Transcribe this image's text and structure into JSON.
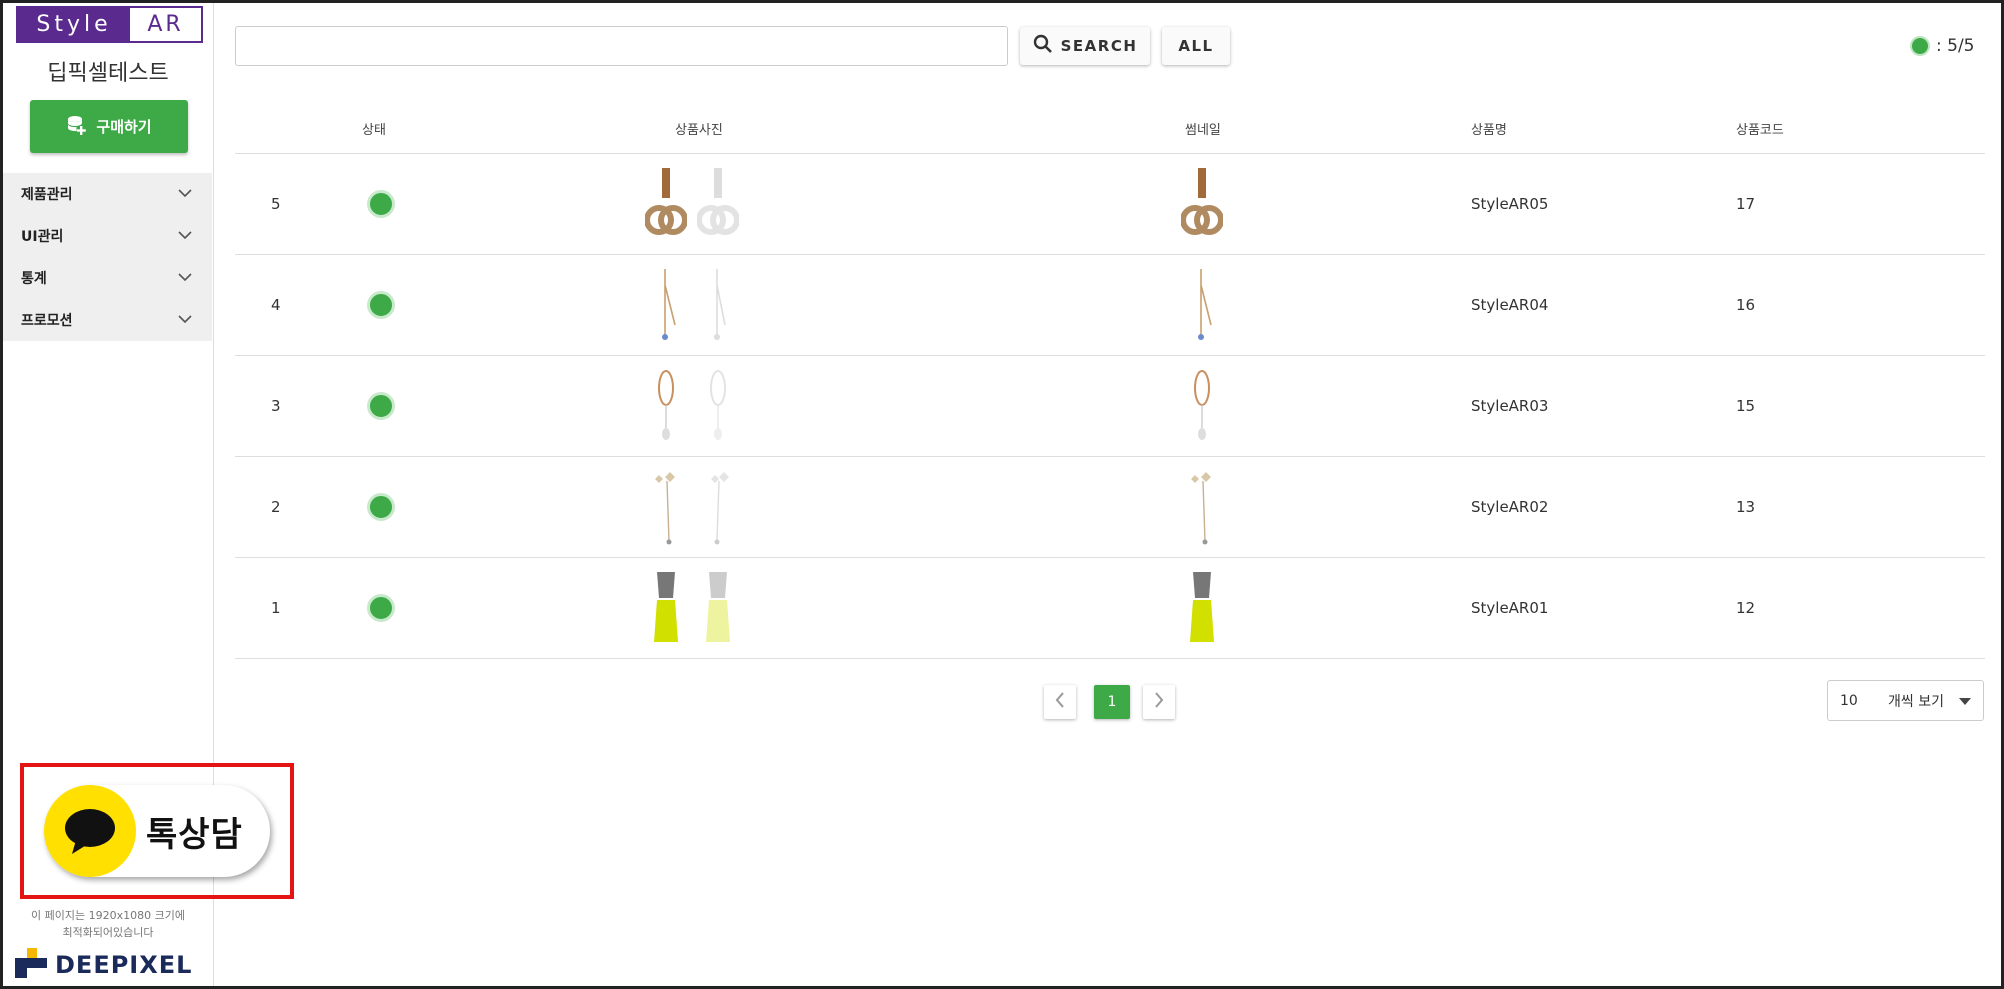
{
  "sidebar": {
    "brand_left": "Style",
    "brand_right": "AR",
    "shop_name": "딥픽셀테스트",
    "buy_label": "구매하기",
    "menu": [
      {
        "label": "제품관리"
      },
      {
        "label": "UI관리"
      },
      {
        "label": "통계"
      },
      {
        "label": "프로모션"
      }
    ],
    "talk_label": "톡상담",
    "optimize_note_1": "이 페이지는 1920x1080 크기에",
    "optimize_note_2": "최적화되어있습니다",
    "logo_text": "DEEPIXEL"
  },
  "topbar": {
    "search_value": "",
    "search_label": "SEARCH",
    "all_label": "ALL",
    "status_count": ": 5/5"
  },
  "table": {
    "headers": {
      "status": "상태",
      "photo": "상품사진",
      "thumbnail": "썸네일",
      "name": "상품명",
      "code": "상품코드"
    },
    "rows": [
      {
        "num": "5",
        "name": "StyleAR05",
        "code": "17",
        "icon": "chanel-earring-image"
      },
      {
        "num": "4",
        "name": "StyleAR04",
        "code": "16",
        "icon": "chain-drop-earring-image"
      },
      {
        "num": "3",
        "name": "StyleAR03",
        "code": "15",
        "icon": "hoop-earring-image"
      },
      {
        "num": "2",
        "name": "StyleAR02",
        "code": "13",
        "icon": "star-drop-earring-image"
      },
      {
        "num": "1",
        "name": "StyleAR01",
        "code": "12",
        "icon": "neon-yellow-earring-image"
      }
    ]
  },
  "pagination": {
    "current": "1"
  },
  "per_page": {
    "value": "10",
    "label": "개씩 보기"
  },
  "colors": {
    "brand": "#5b2a8e",
    "accent": "#3daa47",
    "highlight": "#e41414",
    "kakao": "#ffe000"
  }
}
